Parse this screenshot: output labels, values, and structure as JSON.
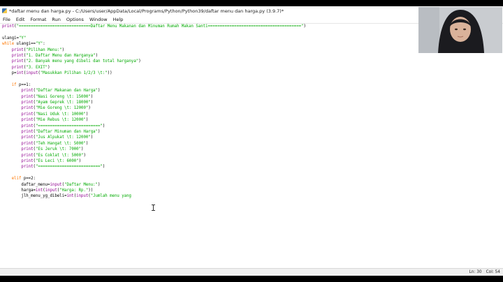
{
  "window": {
    "title": "*daftar menu dan harga.py - C:/Users/user/AppData/Local/Programs/Python/Python39/daftar menu dan harga.py (3.9.7)*"
  },
  "menu": [
    "File",
    "Edit",
    "Format",
    "Run",
    "Options",
    "Window",
    "Help"
  ],
  "code_lines": [
    [
      [
        "bi",
        "print"
      ],
      [
        "tx",
        "("
      ],
      [
        "str",
        "\"==============================Daftar Menu Makanan dan Minuman Rumah Makan Santi=======================================\""
      ],
      [
        "tx",
        ")"
      ]
    ],
    [],
    [
      [
        "tx",
        "ulangi="
      ],
      [
        "str",
        "\"Y\""
      ]
    ],
    [
      [
        "kw",
        "while"
      ],
      [
        "tx",
        " ulangi=="
      ],
      [
        "str",
        "\"Y\""
      ],
      [
        "tx",
        ":"
      ]
    ],
    [
      [
        "tx",
        "    "
      ],
      [
        "bi",
        "print"
      ],
      [
        "tx",
        "("
      ],
      [
        "str",
        "\"Pilihan Menu:\""
      ],
      [
        "tx",
        ")"
      ]
    ],
    [
      [
        "tx",
        "    "
      ],
      [
        "bi",
        "print"
      ],
      [
        "tx",
        "("
      ],
      [
        "str",
        "\"1. Daftar Menu dan Harganya\""
      ],
      [
        "tx",
        ")"
      ]
    ],
    [
      [
        "tx",
        "    "
      ],
      [
        "bi",
        "print"
      ],
      [
        "tx",
        "("
      ],
      [
        "str",
        "\"2. Banyak menu yang dibeli dan total harganya\""
      ],
      [
        "tx",
        ")"
      ]
    ],
    [
      [
        "tx",
        "    "
      ],
      [
        "bi",
        "print"
      ],
      [
        "tx",
        "("
      ],
      [
        "str",
        "\"3. EXIT\""
      ],
      [
        "tx",
        ")"
      ]
    ],
    [
      [
        "tx",
        "    p="
      ],
      [
        "bi",
        "int"
      ],
      [
        "tx",
        "("
      ],
      [
        "bi",
        "input"
      ],
      [
        "tx",
        "("
      ],
      [
        "str",
        "\"Masukkan Pilihan 1/2/3 \\t:\""
      ],
      [
        "tx",
        "))"
      ]
    ],
    [],
    [
      [
        "tx",
        "    "
      ],
      [
        "kw",
        "if"
      ],
      [
        "tx",
        " p==1:"
      ]
    ],
    [
      [
        "tx",
        "        "
      ],
      [
        "bi",
        "print"
      ],
      [
        "tx",
        "("
      ],
      [
        "str",
        "\"Daftar Makanan dan Harga\""
      ],
      [
        "tx",
        ")"
      ]
    ],
    [
      [
        "tx",
        "        "
      ],
      [
        "bi",
        "print"
      ],
      [
        "tx",
        "("
      ],
      [
        "str",
        "\"Nasi Goreng \\t: 15000\""
      ],
      [
        "tx",
        ")"
      ]
    ],
    [
      [
        "tx",
        "        "
      ],
      [
        "bi",
        "print"
      ],
      [
        "tx",
        "("
      ],
      [
        "str",
        "\"Ayam Geprek \\t: 18000\""
      ],
      [
        "tx",
        ")"
      ]
    ],
    [
      [
        "tx",
        "        "
      ],
      [
        "bi",
        "print"
      ],
      [
        "tx",
        "("
      ],
      [
        "str",
        "\"Mie Goreng \\t: 12000\""
      ],
      [
        "tx",
        ")"
      ]
    ],
    [
      [
        "tx",
        "        "
      ],
      [
        "bi",
        "print"
      ],
      [
        "tx",
        "("
      ],
      [
        "str",
        "\"Nasi Uduk \\t: 10000\""
      ],
      [
        "tx",
        ")"
      ]
    ],
    [
      [
        "tx",
        "        "
      ],
      [
        "bi",
        "print"
      ],
      [
        "tx",
        "("
      ],
      [
        "str",
        "\"Mie Rebus \\t: 12000\""
      ],
      [
        "tx",
        ")"
      ]
    ],
    [
      [
        "tx",
        "        "
      ],
      [
        "bi",
        "print"
      ],
      [
        "tx",
        "("
      ],
      [
        "str",
        "\"==========================\""
      ],
      [
        "tx",
        ")"
      ]
    ],
    [
      [
        "tx",
        "        "
      ],
      [
        "bi",
        "print"
      ],
      [
        "tx",
        "("
      ],
      [
        "str",
        "\"Daftar Minuman dan Harga\""
      ],
      [
        "tx",
        ")"
      ]
    ],
    [
      [
        "tx",
        "        "
      ],
      [
        "bi",
        "print"
      ],
      [
        "tx",
        "("
      ],
      [
        "str",
        "\"Jus Alpukat \\t: 12000\""
      ],
      [
        "tx",
        ")"
      ]
    ],
    [
      [
        "tx",
        "        "
      ],
      [
        "bi",
        "print"
      ],
      [
        "tx",
        "("
      ],
      [
        "str",
        "\"Teh Hangat \\t: 5000\""
      ],
      [
        "tx",
        ")"
      ]
    ],
    [
      [
        "tx",
        "        "
      ],
      [
        "bi",
        "print"
      ],
      [
        "tx",
        "("
      ],
      [
        "str",
        "\"Es Jeruk \\t: 7000\""
      ],
      [
        "tx",
        ")"
      ]
    ],
    [
      [
        "tx",
        "        "
      ],
      [
        "bi",
        "print"
      ],
      [
        "tx",
        "("
      ],
      [
        "str",
        "\"Es Coklat \\t: 5000\""
      ],
      [
        "tx",
        ")"
      ]
    ],
    [
      [
        "tx",
        "        "
      ],
      [
        "bi",
        "print"
      ],
      [
        "tx",
        "("
      ],
      [
        "str",
        "\"Es Leci \\t: 6000\""
      ],
      [
        "tx",
        ")"
      ]
    ],
    [
      [
        "tx",
        "        "
      ],
      [
        "bi",
        "print"
      ],
      [
        "tx",
        "("
      ],
      [
        "str",
        "\"==========================\""
      ],
      [
        "tx",
        ")"
      ]
    ],
    [],
    [
      [
        "tx",
        "    "
      ],
      [
        "kw",
        "elif"
      ],
      [
        "tx",
        " p==2:"
      ]
    ],
    [
      [
        "tx",
        "        daftar_menu="
      ],
      [
        "bi",
        "input"
      ],
      [
        "tx",
        "("
      ],
      [
        "str",
        "\"Daftar Menu:\""
      ],
      [
        "tx",
        ")"
      ]
    ],
    [
      [
        "tx",
        "        harga="
      ],
      [
        "bi",
        "int"
      ],
      [
        "tx",
        "("
      ],
      [
        "bi",
        "input"
      ],
      [
        "tx",
        "("
      ],
      [
        "str",
        "\"Harga: Rp.\""
      ],
      [
        "tx",
        "))"
      ]
    ],
    [
      [
        "tx",
        "        jlh_menu_yg_dibeli="
      ],
      [
        "bi",
        "int"
      ],
      [
        "tx",
        "("
      ],
      [
        "bi",
        "input"
      ],
      [
        "tx",
        "("
      ],
      [
        "str",
        "\"Jumlah menu yang"
      ]
    ]
  ],
  "status": {
    "line": "Ln: 30",
    "col": "Col: 54"
  },
  "colors": {
    "keyword": "#ff7700",
    "builtin": "#900090",
    "string": "#00aa00"
  }
}
